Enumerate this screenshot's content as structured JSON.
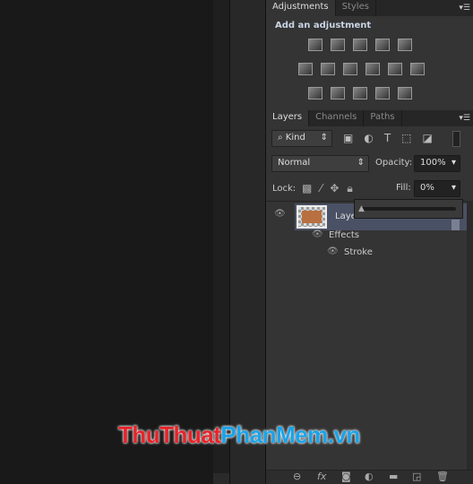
{
  "adjustments_panel": {
    "tabs": [
      "Adjustments",
      "Styles"
    ],
    "heading": "Add an adjustment",
    "icon_rows": [
      [
        "brightness-contrast-icon",
        "levels-icon",
        "curves-icon",
        "exposure-icon",
        "vibrance-icon"
      ],
      [
        "hue-saturation-icon",
        "color-balance-icon",
        "black-white-icon",
        "photo-filter-icon",
        "channel-mixer-icon",
        "color-lookup-icon"
      ],
      [
        "invert-icon",
        "posterize-icon",
        "threshold-icon",
        "selective-color-icon",
        "gradient-map-icon"
      ]
    ]
  },
  "layers_panel": {
    "tabs": [
      "Layers",
      "Channels",
      "Paths"
    ],
    "filter": {
      "value": "Kind"
    },
    "blend_mode": "Normal",
    "opacity_label": "Opacity:",
    "opacity": "100%",
    "lock_label": "Lock:",
    "fill_label": "Fill:",
    "fill": "0%",
    "fill_slider_percent": 0,
    "layers": [
      {
        "name": "Laye",
        "effects_label": "Effects",
        "effects": [
          "Stroke"
        ],
        "thumb_color": "#b87040"
      }
    ],
    "footer_icons": [
      "link-icon",
      "fx-icon",
      "mask-icon",
      "adjustment-icon",
      "folder-icon",
      "new-layer-icon",
      "trash-icon"
    ]
  },
  "watermark": {
    "part1": "ThuThuat",
    "part2": "PhanMem.vn",
    "color1": "#e8232a",
    "color2": "#1aa3e8"
  }
}
